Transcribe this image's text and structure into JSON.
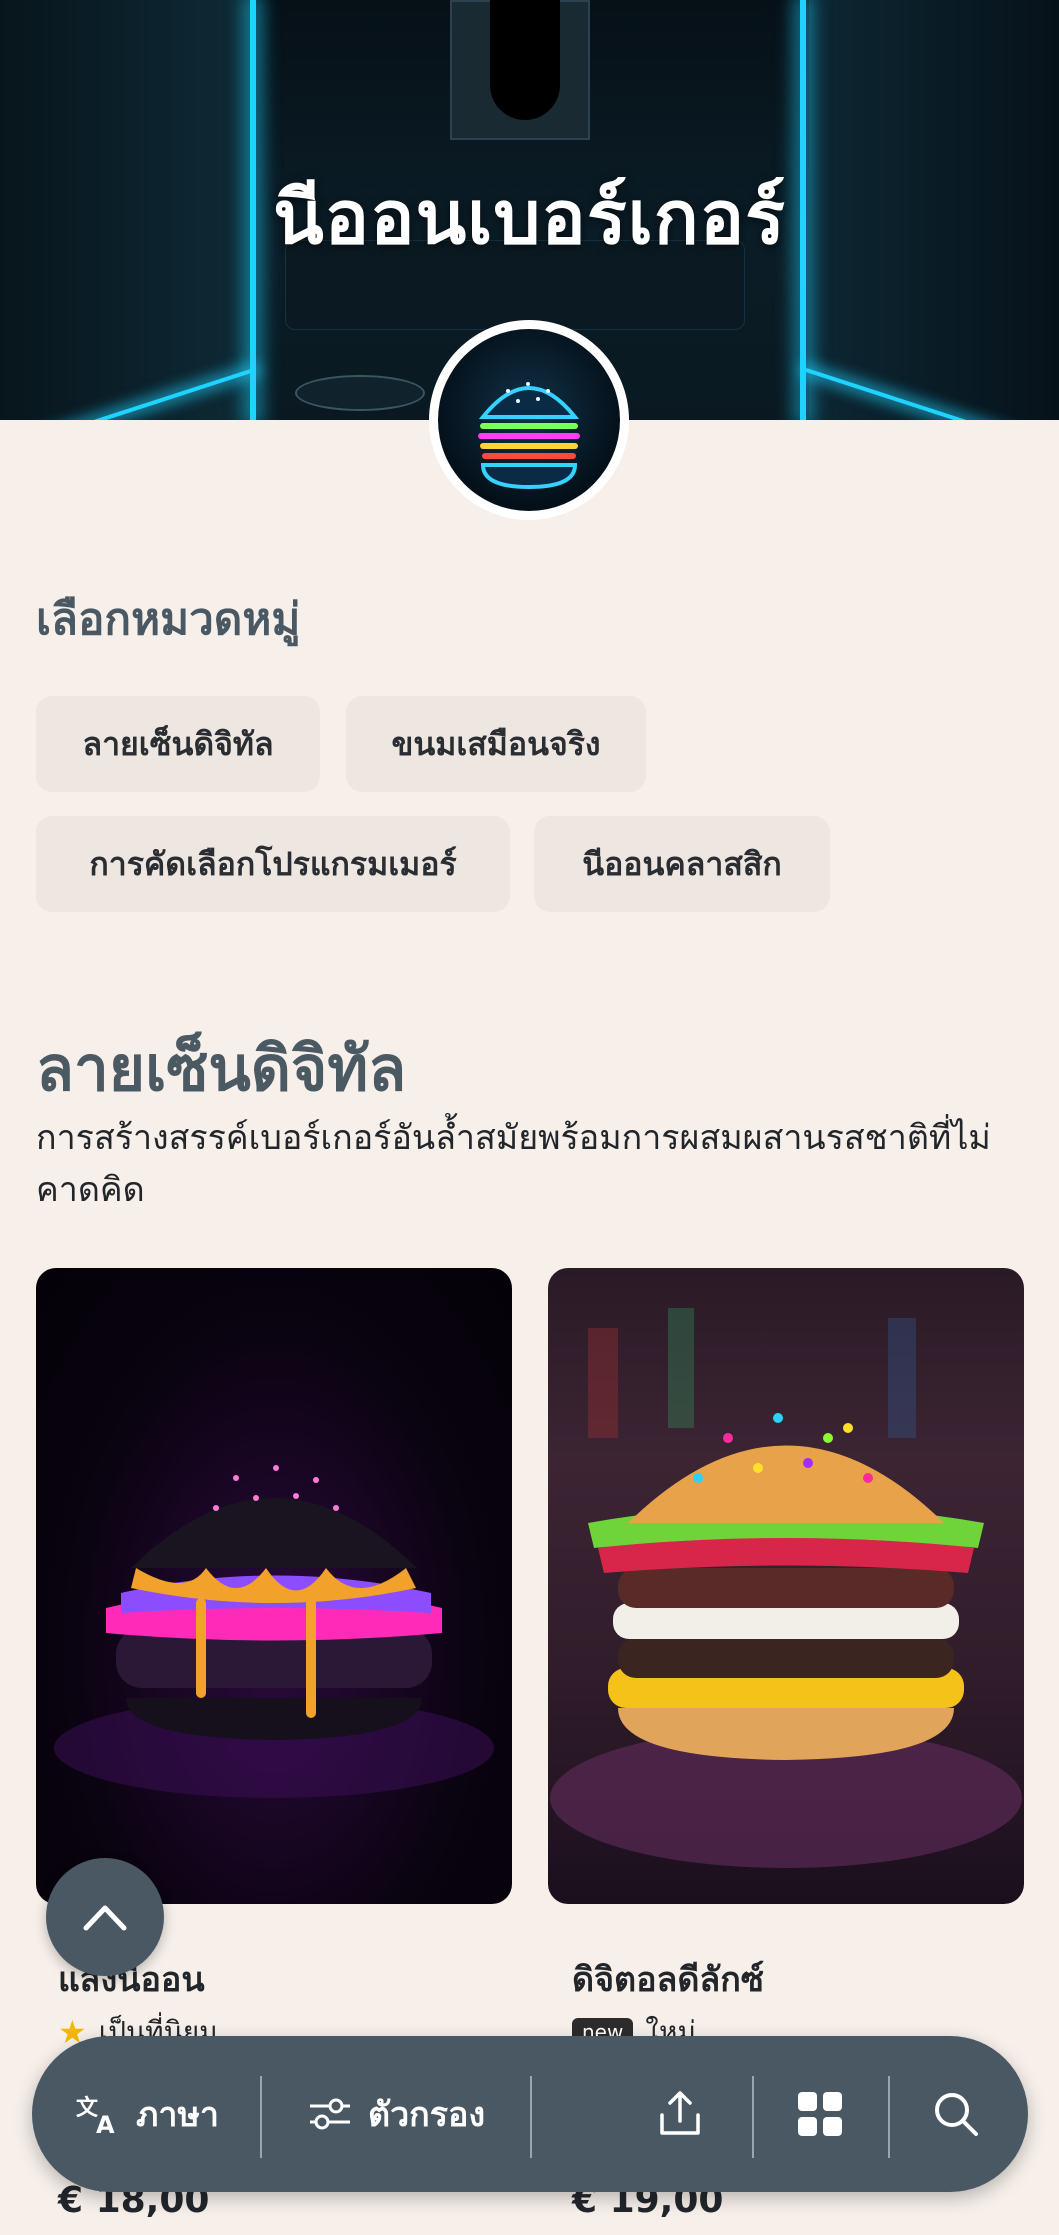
{
  "restaurant": {
    "name": "นีออนเบอร์เกอร์"
  },
  "categories": {
    "heading": "เลือกหมวดหมู่",
    "items": [
      {
        "label": "ลายเซ็นดิจิทัล"
      },
      {
        "label": "ขนมเสมือนจริง"
      },
      {
        "label": "การคัดเลือกโปรแกรมเมอร์"
      },
      {
        "label": "นีออนคลาสสิก"
      }
    ]
  },
  "section": {
    "title": "ลายเซ็นดิจิทัล",
    "description": "การสร้างสรรค์เบอร์เกอร์อันล้ำสมัยพร้อมการผสมผสานรสชาติที่ไม่คาดคิด"
  },
  "products": [
    {
      "name": "แสงนีออน",
      "tag": "เป็นที่นิยม",
      "tag_icon": "star-icon",
      "price": "€ 18,00"
    },
    {
      "name": "ดิจิตอลดีลักซ์",
      "tag": "ใหม่",
      "badge": "new",
      "price": "€ 19,00"
    }
  ],
  "bottom_bar": {
    "language_label": "ภาษา",
    "filter_label": "ตัวกรอง"
  },
  "colors": {
    "primary": "#4a5863",
    "background": "#f6efea",
    "chip": "#eee6e1",
    "neon": "#1fd3ff",
    "star": "#f5b800"
  }
}
